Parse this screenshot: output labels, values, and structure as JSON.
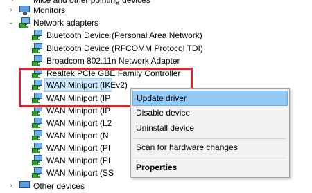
{
  "tree": {
    "cut_top_label": "Mice and other pointing devices",
    "monitors_label": "Monitors",
    "network_adapters_label": "Network adapters",
    "adapters": [
      "Bluetooth Device (Personal Area Network)",
      "Bluetooth Device (RFCOMM Protocol TDI)",
      "Broadcom 802.11n Network Adapter",
      "Realtek PCIe GBE Family Controller",
      "WAN Miniport (IKEv2)",
      "WAN Miniport (IP",
      "WAN Miniport (IP",
      "WAN Miniport (L2",
      "WAN Miniport (N",
      "WAN Miniport (PI",
      "WAN Miniport (PI",
      "WAN Miniport (SS"
    ],
    "other_devices_label": "Other devices"
  },
  "context_menu": {
    "update_driver": "Update driver",
    "disable_device": "Disable device",
    "uninstall_device": "Uninstall device",
    "scan_hardware": "Scan for hardware changes",
    "properties": "Properties"
  },
  "colors": {
    "highlight_box": "#d9252b",
    "menu_hover": "#91c9f7",
    "selection": "#cce8ff"
  }
}
